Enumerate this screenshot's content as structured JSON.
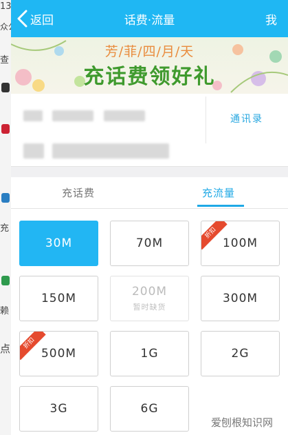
{
  "behind": {
    "frag_time": "13",
    "frag_public": "众公",
    "frag_see": "查",
    "frag_charge": "充",
    "frag_stay": "赖",
    "frag_dot": "点"
  },
  "header": {
    "back_label": "返回",
    "title": "话费·流量",
    "right_label": "我"
  },
  "banner": {
    "line1": "芳/菲/四/月/天",
    "line2": "充话费领好礼"
  },
  "phone": {
    "contacts_label": "通讯录"
  },
  "tabs": [
    {
      "label": "充话费",
      "active": false
    },
    {
      "label": "充流量",
      "active": true
    }
  ],
  "packages": [
    {
      "value": "30M",
      "selected": true,
      "disabled": false,
      "discount": false
    },
    {
      "value": "70M",
      "selected": false,
      "disabled": false,
      "discount": false
    },
    {
      "value": "100M",
      "selected": false,
      "disabled": false,
      "discount": true
    },
    {
      "value": "150M",
      "selected": false,
      "disabled": false,
      "discount": false
    },
    {
      "value": "200M",
      "selected": false,
      "disabled": true,
      "discount": false,
      "note": "暂时缺货"
    },
    {
      "value": "300M",
      "selected": false,
      "disabled": false,
      "discount": false
    },
    {
      "value": "500M",
      "selected": false,
      "disabled": false,
      "discount": true
    },
    {
      "value": "1G",
      "selected": false,
      "disabled": false,
      "discount": false
    },
    {
      "value": "2G",
      "selected": false,
      "disabled": false,
      "discount": false
    },
    {
      "value": "3G",
      "selected": false,
      "disabled": false,
      "discount": false
    },
    {
      "value": "6G",
      "selected": false,
      "disabled": false,
      "discount": false
    }
  ],
  "discount_badge": "折扣",
  "watermark": "爱刨根知识网",
  "colors": {
    "accent": "#1fb7f3",
    "tab_active": "#1fa9e6",
    "badge": "#e54a2e",
    "banner_title": "#3f9a2e"
  }
}
